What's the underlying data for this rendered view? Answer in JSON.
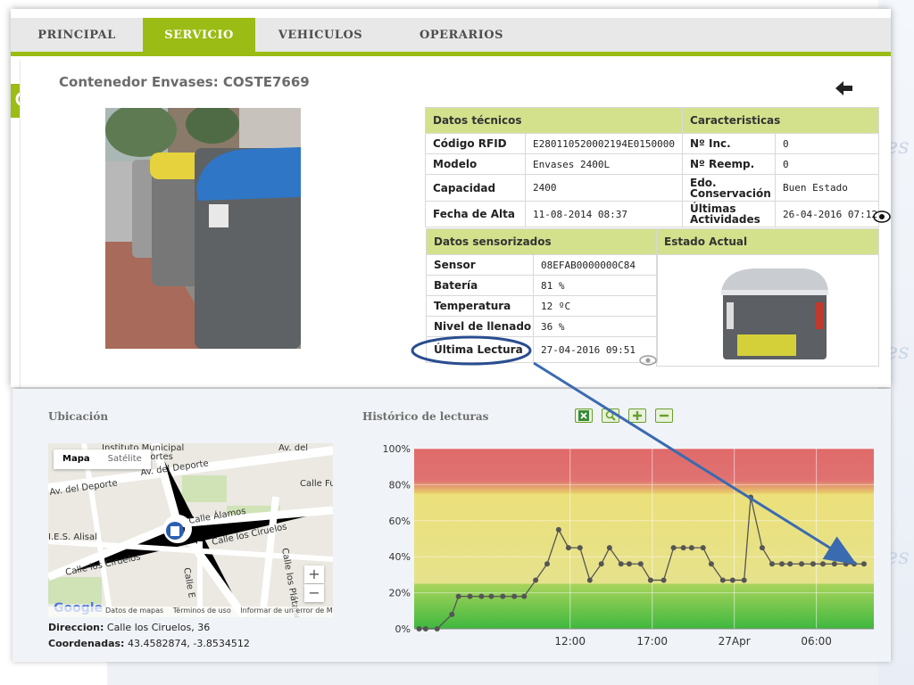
{
  "nav": {
    "tabs": [
      {
        "label": "PRINCIPAL"
      },
      {
        "label": "SERVICIO",
        "active": true
      },
      {
        "label": "VEHICULOS"
      },
      {
        "label": "OPERARIOS"
      }
    ]
  },
  "page": {
    "title": "Contenedor Envases: COSTE7669"
  },
  "datos_tecnicos": {
    "header": "Datos técnicos",
    "rows": [
      {
        "label": "Código RFID",
        "value": "E280110520002194E0150000"
      },
      {
        "label": "Modelo",
        "value": "Envases 2400L"
      },
      {
        "label": "Capacidad",
        "value": "2400"
      },
      {
        "label": "Fecha de Alta",
        "value": "11-08-2014 08:37"
      }
    ]
  },
  "caracteristicas": {
    "header": "Caracteristicas",
    "rows": [
      {
        "label": "Nº Inc.",
        "value": "0"
      },
      {
        "label": "Nº Reemp.",
        "value": "0"
      },
      {
        "label": "Edo. Conservación",
        "value": "Buen Estado"
      },
      {
        "label": "Últimas Actividades",
        "value": "26-04-2016 07:12"
      }
    ]
  },
  "datos_sensorizados": {
    "header": "Datos sensorizados",
    "rows": [
      {
        "label": "Sensor",
        "value": "08EFAB0000000C84"
      },
      {
        "label": "Batería",
        "value": "81 %"
      },
      {
        "label": "Temperatura",
        "value": "12 ºC"
      },
      {
        "label": "Nivel de llenado",
        "value": "36 %"
      },
      {
        "label": "Última Lectura",
        "value": "27-04-2016 09:51"
      }
    ]
  },
  "estado_actual": {
    "header": "Estado Actual"
  },
  "ubicacion": {
    "title": "Ubicación",
    "map_type": [
      "Mapa",
      "Satélite"
    ],
    "zoom_in": "+",
    "zoom_out": "−",
    "google": "Google",
    "footer": [
      "Datos de mapas",
      "Términos de uso",
      "Informar de un error de Mapa"
    ],
    "streets": [
      "Instituto Municipal",
      "Av. del",
      "portes",
      "Av. del Deporte",
      "Av. del Deporte",
      "Calle Fu",
      "Calle Álamos",
      "I.E.S. Alisal",
      "Calle los Ciruelos",
      "Calle los Ciruelos",
      "Calle E",
      "Calle los Plátanos"
    ],
    "direccion_label": "Direccion:",
    "direccion": "Calle los Ciruelos, 36",
    "coordenadas_label": "Coordenadas:",
    "coordenadas": "43.4582874, -3.8534512"
  },
  "historico": {
    "title": "Histórico de lecturas",
    "buttons": [
      "excel-icon",
      "search-icon",
      "plus-icon",
      "minus-icon"
    ]
  },
  "colors": {
    "accent": "#9bbc14",
    "header_cell": "#d4e18c",
    "annotation": "#3a6bb0"
  },
  "chart_data": {
    "type": "line",
    "title": "",
    "xlabel": "",
    "ylabel": "",
    "ylim": [
      0,
      100
    ],
    "yticks": [
      "0%",
      "20%",
      "40%",
      "60%",
      "80%",
      "100%"
    ],
    "xticks": [
      {
        "x": 9.5,
        "label": "12:00"
      },
      {
        "x": 14.5,
        "label": "17:00"
      },
      {
        "x": 19.5,
        "label": "27Apr"
      },
      {
        "x": 24.5,
        "label": "06:00"
      }
    ],
    "xlim": [
      0,
      28
    ],
    "bands": [
      {
        "from": 0,
        "to": 25,
        "color": "green"
      },
      {
        "from": 25,
        "to": 75,
        "color": "yellow"
      },
      {
        "from": 75,
        "to": 100,
        "color": "red"
      }
    ],
    "series": [
      {
        "x": [
          0.3,
          0.7,
          1.4,
          2.3,
          2.7,
          3.4,
          4.1,
          4.7,
          5.4,
          6.1,
          6.7,
          7.4,
          8.1,
          8.8,
          9.4,
          10.1,
          10.7,
          11.4,
          11.9,
          12.6,
          13.1,
          13.8,
          14.4,
          15.2,
          15.8,
          16.4,
          16.9,
          17.6,
          18.1,
          18.8,
          19.4,
          20.1,
          20.5,
          21.2,
          21.8,
          22.4,
          22.9,
          23.6,
          24.3,
          24.9,
          25.6,
          26.3,
          26.8,
          27.4
        ],
        "y": [
          0,
          0,
          0,
          8,
          18,
          18,
          18,
          18,
          18,
          18,
          18,
          27,
          36,
          55,
          45,
          45,
          27,
          36,
          45,
          36,
          36,
          36,
          27,
          27,
          45,
          45,
          45,
          45,
          36,
          27,
          27,
          27,
          73,
          45,
          36,
          36,
          36,
          36,
          36,
          36,
          36,
          36,
          36,
          36
        ]
      }
    ]
  }
}
